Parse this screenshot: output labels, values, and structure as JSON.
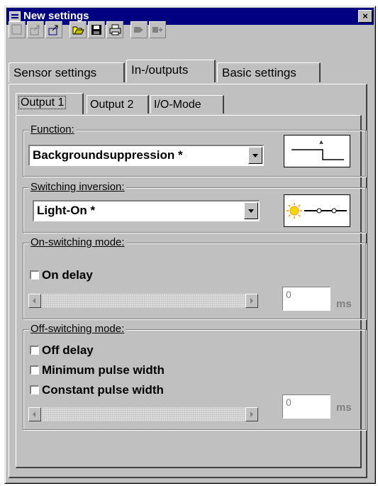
{
  "window": {
    "title": "New settings",
    "close_label": "×"
  },
  "toolbar": {
    "buttons": [
      "new-icon",
      "save-to-sensor-icon",
      "load-from-sensor-icon",
      "open-folder-icon",
      "save-disk-icon",
      "print-icon",
      "play-forward-icon",
      "play-add-icon"
    ]
  },
  "tabs": [
    "Sensor settings",
    "In-/outputs",
    "Basic settings"
  ],
  "subtabs": [
    "Output 1",
    "Output 2",
    "I/O-Mode"
  ],
  "function": {
    "label": "Function:",
    "value": "Backgroundsuppression *"
  },
  "inversion": {
    "label": "Switching inversion:",
    "value": "Light-On *"
  },
  "on_mode": {
    "label": "On-switching mode:",
    "on_delay": "On delay",
    "value": "0",
    "unit": "ms"
  },
  "off_mode": {
    "label": "Off-switching mode:",
    "off_delay": "Off delay",
    "min_pulse": "Minimum pulse width",
    "const_pulse": "Constant pulse width",
    "value": "0",
    "unit": "ms"
  }
}
